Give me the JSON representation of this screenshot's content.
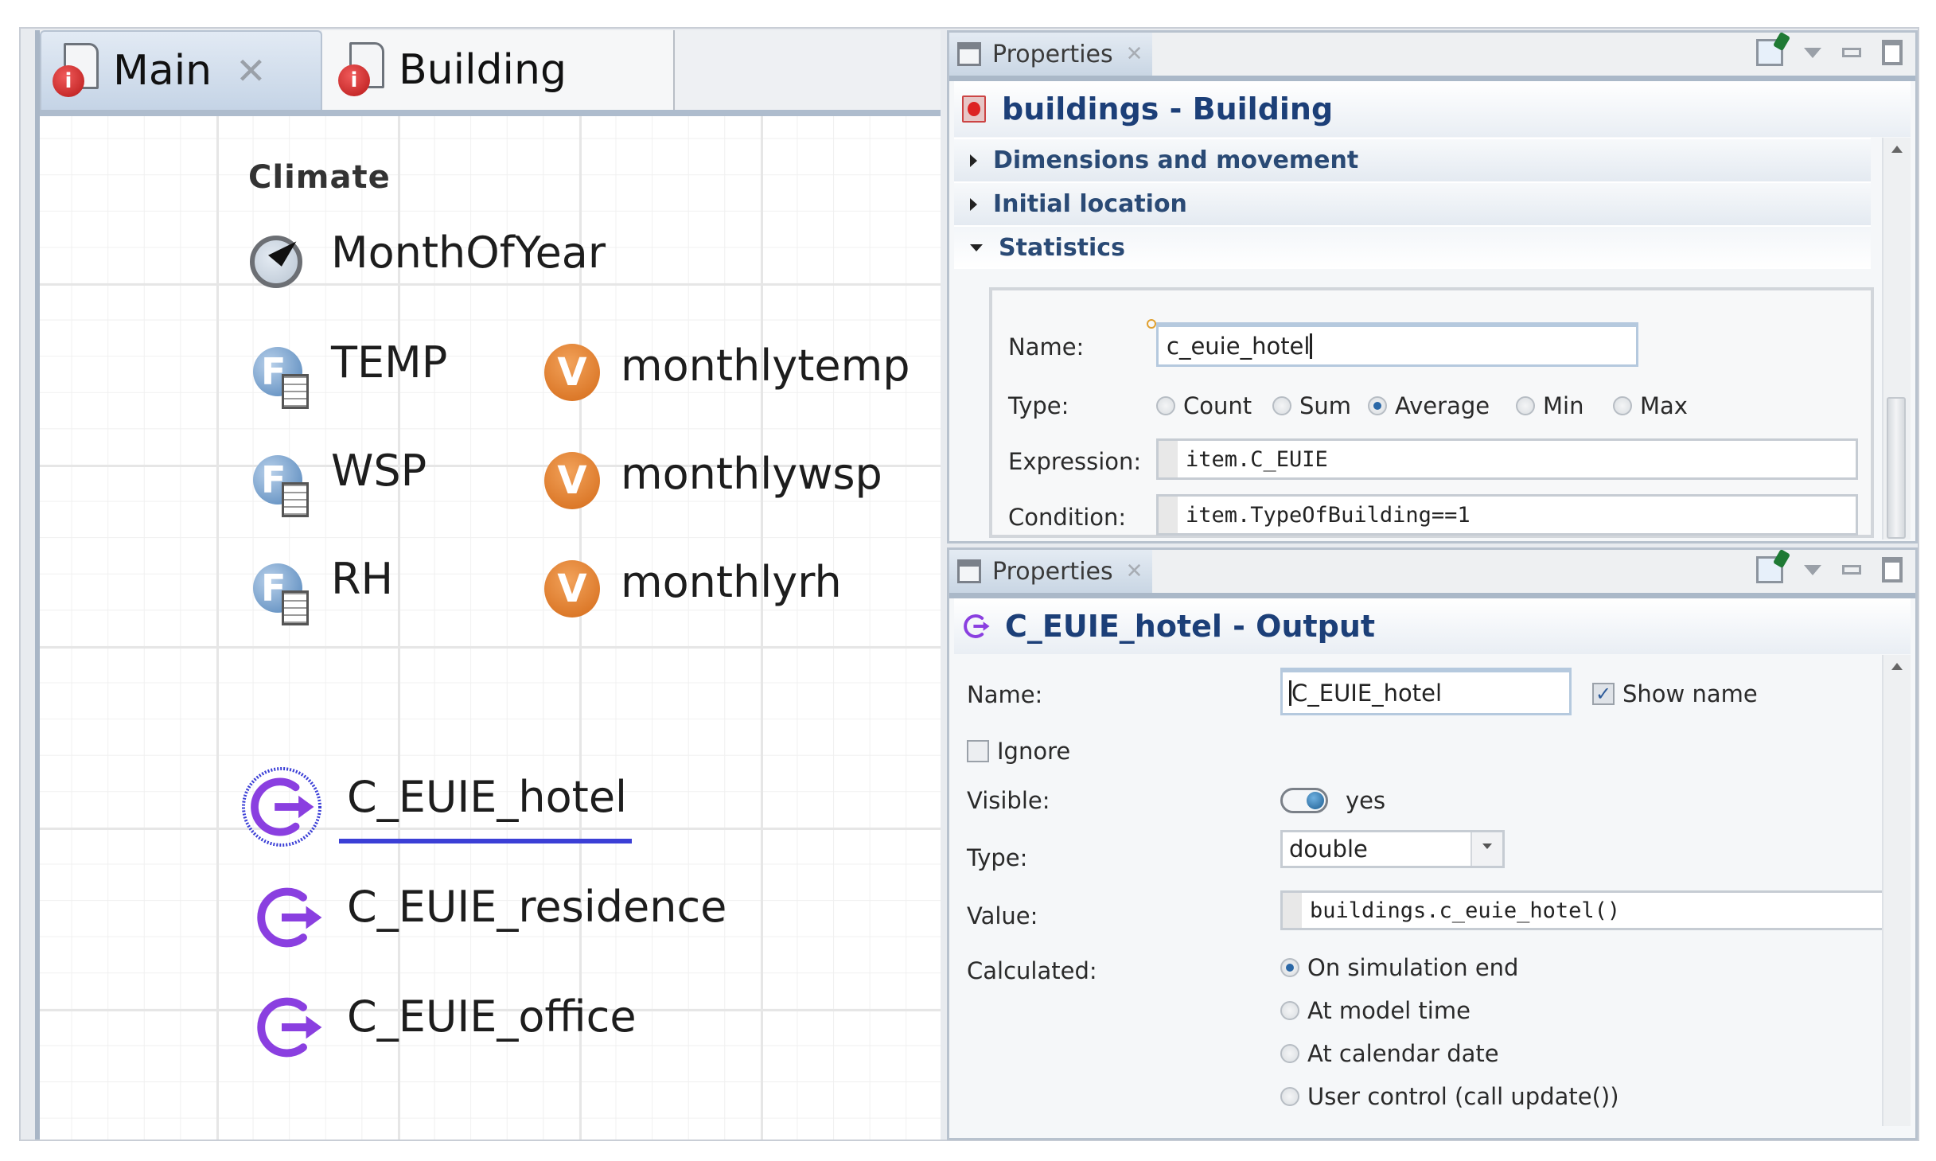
{
  "editor": {
    "tabs": [
      {
        "label": "Main",
        "icon": "agent-type-icon",
        "active": true,
        "closable": true
      },
      {
        "label": "Building",
        "icon": "agent-type-icon",
        "active": false,
        "closable": false
      }
    ],
    "close_glyph": "✕",
    "canvas": {
      "group_label": "Climate",
      "month_of_year": "MonthOfYear",
      "tables": [
        {
          "name": "TEMP",
          "variable": "monthlytemp"
        },
        {
          "name": "WSP",
          "variable": "monthlywsp"
        },
        {
          "name": "RH",
          "variable": "monthlyrh"
        }
      ],
      "table_icon_letter": "F",
      "variable_icon_letter": "V",
      "outputs": [
        {
          "name": "C_EUIE_hotel",
          "selected": true
        },
        {
          "name": "C_EUIE_residence",
          "selected": false
        },
        {
          "name": "C_EUIE_office",
          "selected": false
        }
      ]
    }
  },
  "properties_top": {
    "tab_label": "Properties",
    "close_glyph": "✕",
    "title": "buildings - Building",
    "sections": [
      {
        "label": "Dimensions and movement",
        "expanded": false
      },
      {
        "label": "Initial location",
        "expanded": false
      },
      {
        "label": "Statistics",
        "expanded": true
      }
    ],
    "statistics": {
      "name_label": "Name:",
      "name_value": "c_euie_hotel",
      "type_label": "Type:",
      "type_options": [
        "Count",
        "Sum",
        "Average",
        "Min",
        "Max"
      ],
      "type_selected": "Average",
      "expression_label": "Expression:",
      "expression_value": "item.C_EUIE",
      "condition_label": "Condition:",
      "condition_value": "item.TypeOfBuilding==1"
    }
  },
  "properties_bottom": {
    "tab_label": "Properties",
    "close_glyph": "✕",
    "title": "C_EUIE_hotel - Output",
    "name_label": "Name:",
    "name_value": "C_EUIE_hotel",
    "show_name_label": "Show name",
    "show_name_checked": true,
    "ignore_label": "Ignore",
    "ignore_checked": false,
    "visible_label": "Visible:",
    "visible_value": "yes",
    "type_label": "Type:",
    "type_value": "double",
    "value_label": "Value:",
    "value_value": "buildings.c_euie_hotel()",
    "calculated_label": "Calculated:",
    "calculated_options": [
      "On simulation end",
      "At model time",
      "At calendar date",
      "User control (call update())"
    ],
    "calculated_selected": "On simulation end"
  }
}
